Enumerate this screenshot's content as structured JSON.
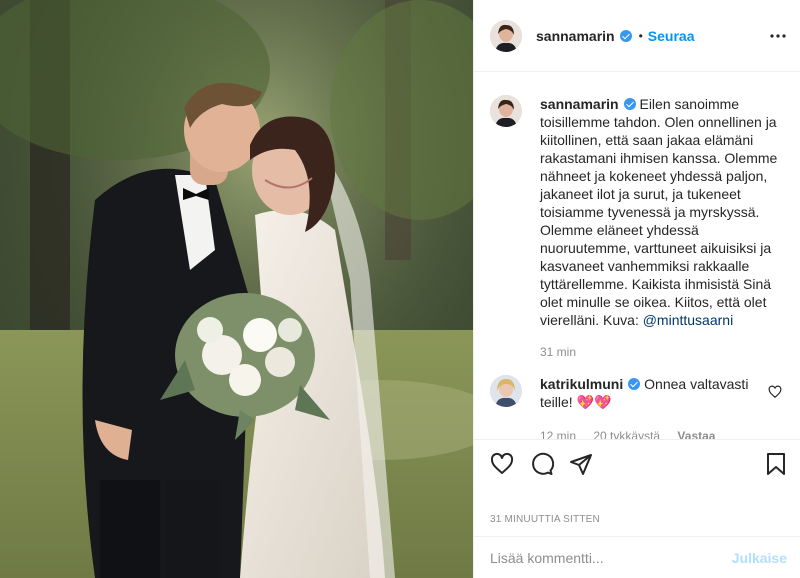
{
  "post_image": {
    "alt": "Hääkuva"
  },
  "header": {
    "username": "sannamarin",
    "dot": "•",
    "follow_label": "Seuraa",
    "more_label": "•••",
    "avatar_icon": "profile-avatar"
  },
  "caption": {
    "username": "sannamarin",
    "text": "Eilen sanoimme toisillemme tahdon. Olen onnellinen ja kiitollinen, että saan jakaa elämäni rakastamani ihmisen kanssa. Olemme nähneet ja kokeneet yhdessä paljon, jakaneet ilot ja surut, ja tukeneet toisiamme tyvenessä ja myrskyssä. Olemme eläneet yhdessä nuoruutemme, varttuneet aikuisiksi ja kasvaneet vanhemmiksi rakkaalle tyttärellemme. Kaikista ihmisistä Sinä olet minulle se oikea. Kiitos, että olet vierelläni. Kuva: ",
    "mention": "@minttusaarni",
    "time": "31 min"
  },
  "comment": {
    "username": "katrikulmuni",
    "text": "Onnea valtavasti teille! ",
    "emoji": "💖💖",
    "time": "12 min",
    "likes": "20 tykkäystä",
    "reply": "Vastaa"
  },
  "timestamp": "31 minuuttia sitten",
  "add_comment": {
    "placeholder": "Lisää kommentti...",
    "post_label": "Julkaise"
  },
  "colors": {
    "accent": "#0095f6",
    "verified": "#3897f0",
    "muted": "#8e8e8e",
    "post_disabled": "#b2dffc"
  }
}
